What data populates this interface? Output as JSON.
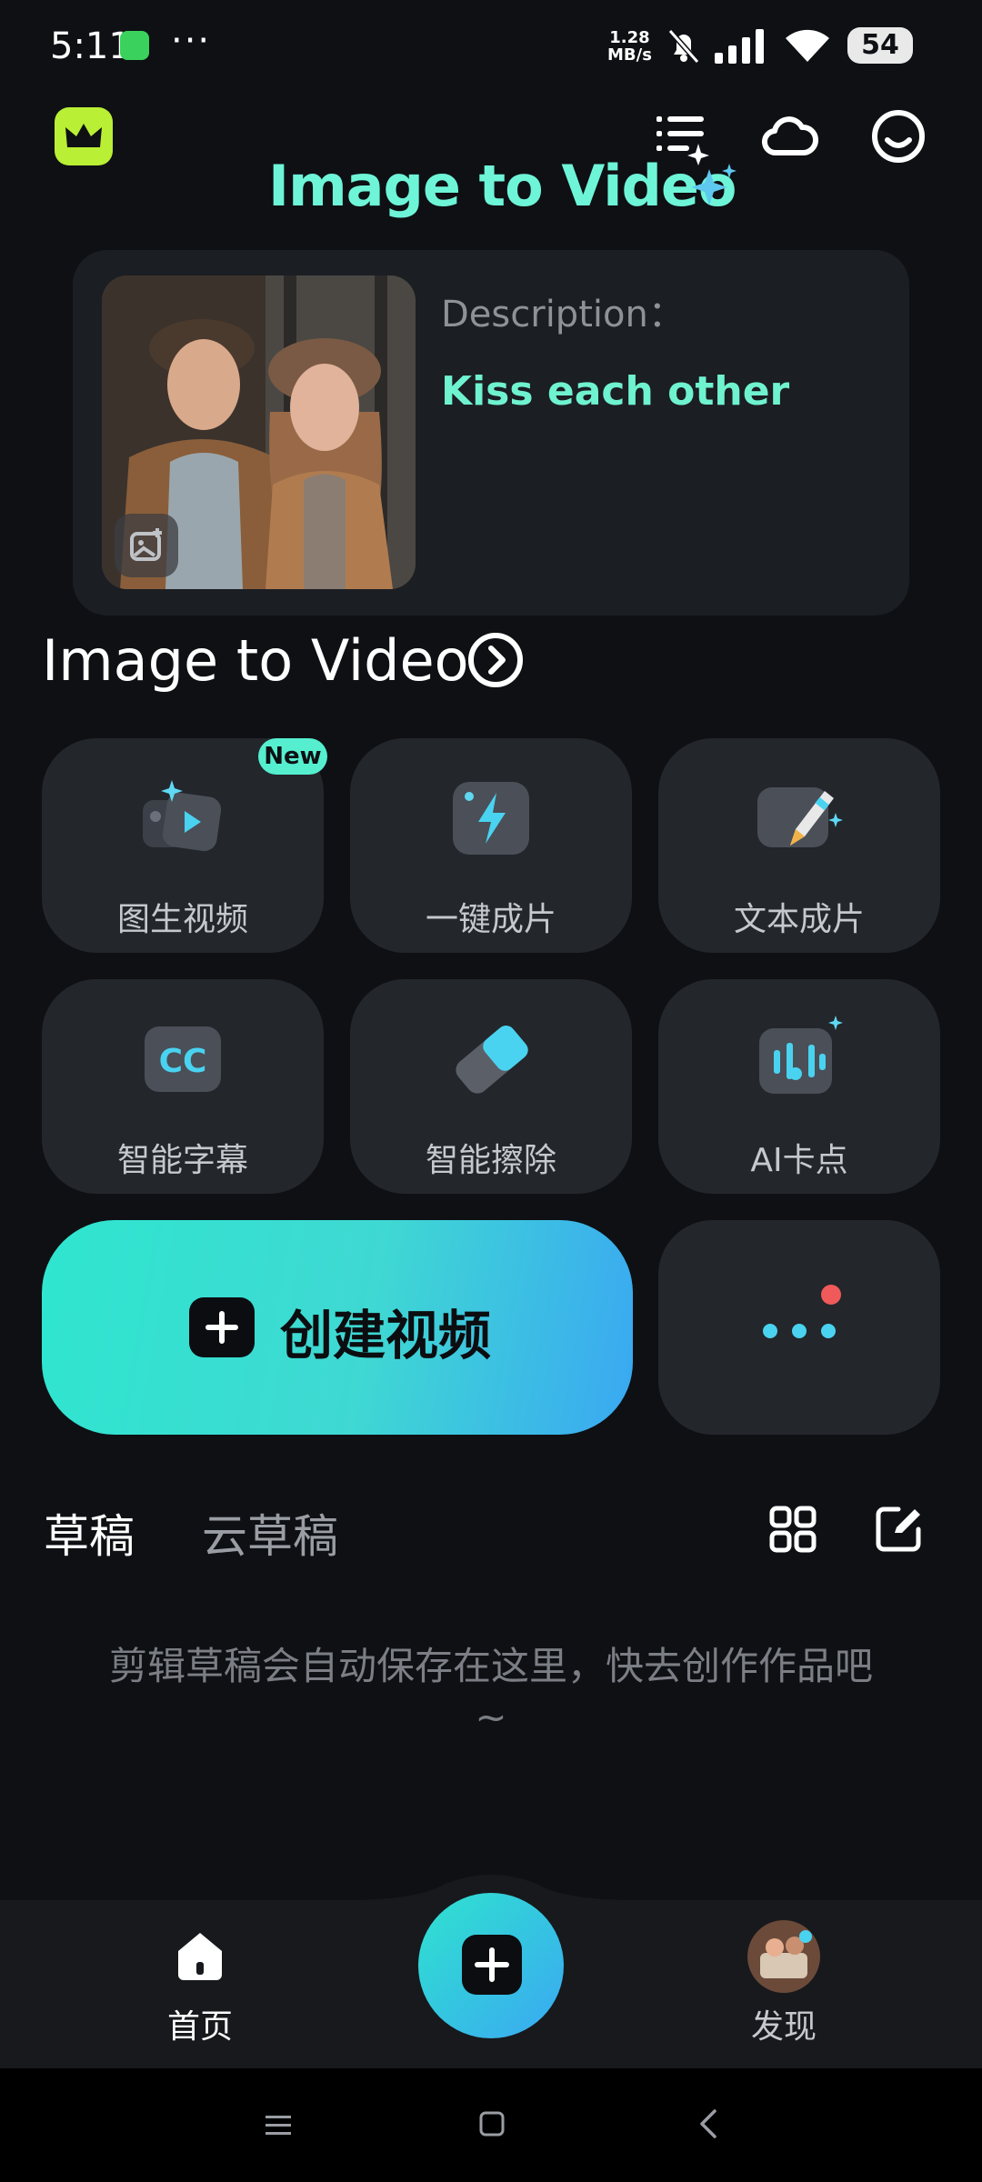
{
  "status_bar": {
    "time": "5:11",
    "overflow": "···",
    "net_speed_value": "1.28",
    "net_speed_unit": "MB/s",
    "battery": "54"
  },
  "banner": {
    "title": "Image to Video",
    "description_label": "Description：",
    "description_value": "Kiss each other"
  },
  "section": {
    "title": "Image to Video"
  },
  "features": [
    {
      "label": "图生视频",
      "badge": "New",
      "icon": "image-to-video-icon"
    },
    {
      "label": "一键成片",
      "icon": "lightning-icon"
    },
    {
      "label": "文本成片",
      "icon": "pencil-icon"
    },
    {
      "label": "智能字幕",
      "icon": "cc-icon"
    },
    {
      "label": "智能擦除",
      "icon": "eraser-icon"
    },
    {
      "label": "AI卡点",
      "icon": "music-beat-icon"
    }
  ],
  "create_button": {
    "label": "创建视频"
  },
  "drafts": {
    "tabs": [
      "草稿",
      "云草稿"
    ],
    "empty_text": "剪辑草稿会自动保存在这里，快去创作作品吧~"
  },
  "bottom_nav": [
    {
      "label": "首页"
    },
    {
      "label": "发现"
    }
  ],
  "colors": {
    "background": "#0e1014",
    "accent_teal": "#6ef5d8",
    "accent_blue": "#3aa8f2",
    "notification_dot": "#f05a5a"
  }
}
